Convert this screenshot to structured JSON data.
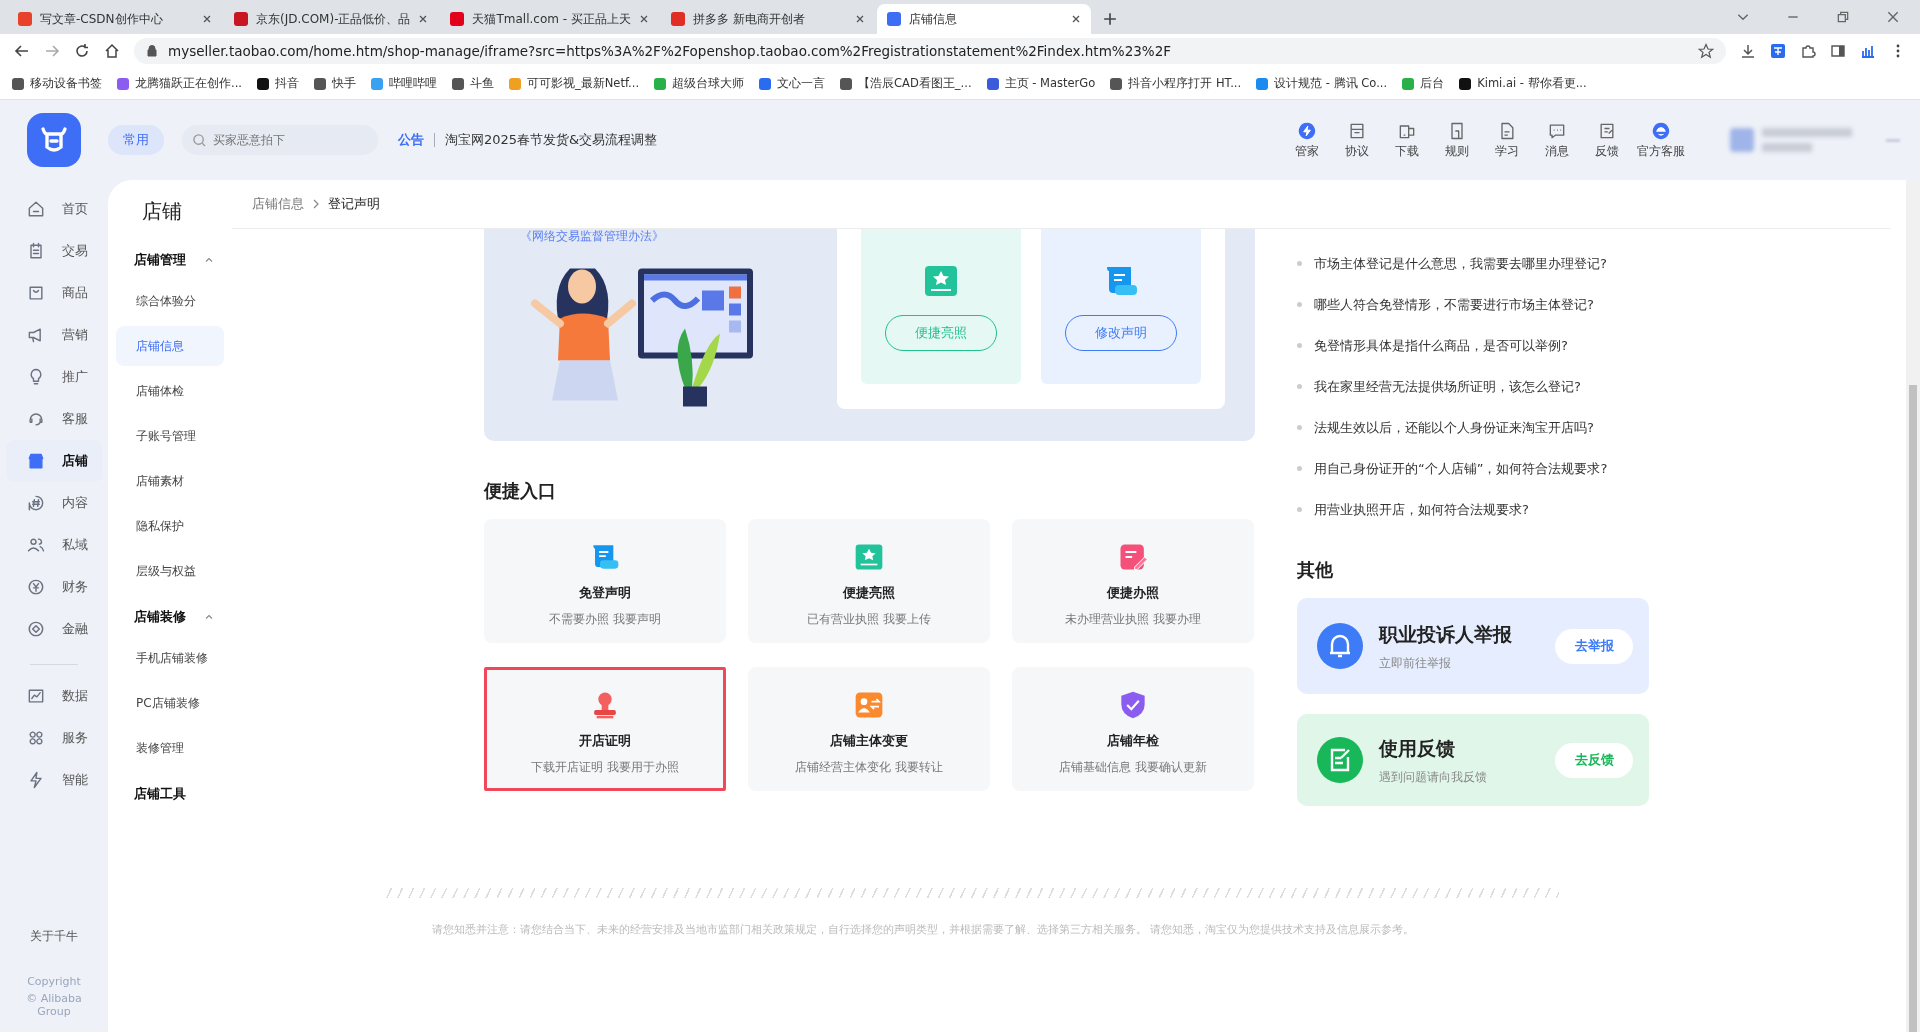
{
  "browser": {
    "tabs": [
      {
        "title": "写文章-CSDN创作中心",
        "selected": false
      },
      {
        "title": "京东(JD.COM)-正品低价、品",
        "selected": false
      },
      {
        "title": "天猫Tmall.com - 买正品上天",
        "selected": false
      },
      {
        "title": "拼多多 新电商开创者",
        "selected": false
      },
      {
        "title": "店铺信息",
        "selected": true
      }
    ],
    "url": "myseller.taobao.com/home.htm/shop-manage/iframe?src=https%3A%2F%2Fopenshop.taobao.com%2Fregistrationstatement%2Findex.htm%23%2F",
    "bookmarks": [
      "移动设备书签",
      "龙腾猫跃正在创作...",
      "抖音",
      "快手",
      "哔哩哔哩",
      "斗鱼",
      "可可影视_最新Netf...",
      "超级台球大师",
      "文心一言",
      "【浩辰CAD看图王_...",
      "主页 - MasterGo",
      "抖音小程序打开 HT...",
      "设计规范 - 腾讯 Co...",
      "后台",
      "Kimi.ai - 帮你看更..."
    ]
  },
  "header": {
    "pill": "常用",
    "search": {
      "placeholder": "买家恶意拍下"
    },
    "notice_label": "公告",
    "notice": "淘宝网2025春节发货&交易流程调整",
    "tools": [
      "管家",
      "协议",
      "下载",
      "规则",
      "学习",
      "消息",
      "反馈",
      "官方客服"
    ]
  },
  "rail": {
    "groups": [
      {
        "items": [
          {
            "label": "首页",
            "selected": false
          },
          {
            "label": "交易",
            "selected": false
          },
          {
            "label": "商品",
            "selected": false
          },
          {
            "label": "营销",
            "selected": false
          },
          {
            "label": "推广",
            "selected": false
          },
          {
            "label": "客服",
            "selected": false
          },
          {
            "label": "店铺",
            "selected": true
          },
          {
            "label": "内容",
            "selected": false
          },
          {
            "label": "私域",
            "selected": false
          },
          {
            "label": "财务",
            "selected": false
          },
          {
            "label": "金融",
            "selected": false
          }
        ]
      },
      {
        "items": [
          {
            "label": "数据",
            "selected": false
          },
          {
            "label": "服务",
            "selected": false
          },
          {
            "label": "智能",
            "selected": false
          }
        ]
      }
    ],
    "about": "关于千牛",
    "copyright": "Copyright",
    "company": "© Alibaba Group"
  },
  "sidebar": {
    "title": "店铺",
    "groups": [
      {
        "kind": "collapsible",
        "label": "店铺管理",
        "expanded": true,
        "items": [
          {
            "label": "综合体验分",
            "selected": false
          },
          {
            "label": "店铺信息",
            "selected": true
          },
          {
            "label": "店铺体检",
            "selected": false
          },
          {
            "label": "子账号管理",
            "selected": false
          },
          {
            "label": "店铺素材",
            "selected": false
          },
          {
            "label": "隐私保护",
            "selected": false
          },
          {
            "label": "层级与权益",
            "selected": false
          }
        ]
      },
      {
        "kind": "collapsible",
        "label": "店铺装修",
        "expanded": true,
        "items": [
          {
            "label": "手机店铺装修",
            "selected": false
          },
          {
            "label": "PC店铺装修",
            "selected": false
          },
          {
            "label": "装修管理",
            "selected": false
          }
        ]
      },
      {
        "kind": "link",
        "label": "店铺工具"
      }
    ]
  },
  "breadcrumb": [
    "店铺信息",
    "登记声明"
  ],
  "banner": {
    "law_link": "《网络交易监督管理办法》",
    "actions": [
      {
        "label": "便捷亮照",
        "color": "#1fbf8f"
      },
      {
        "label": "修改声明",
        "color": "#3d7bf7"
      }
    ]
  },
  "quick_entry": {
    "title": "便捷入口",
    "cards": [
      {
        "title": "免登声明",
        "subtitle": "不需要办照 我要声明",
        "highlighted": false
      },
      {
        "title": "便捷亮照",
        "subtitle": "已有营业执照 我要上传",
        "highlighted": false
      },
      {
        "title": "便捷办照",
        "subtitle": "未办理营业执照 我要办理",
        "highlighted": false
      },
      {
        "title": "开店证明",
        "subtitle": "下载开店证明 我要用于办照",
        "highlighted": true
      },
      {
        "title": "店铺主体变更",
        "subtitle": "店铺经营主体变化 我要转让",
        "highlighted": false
      },
      {
        "title": "店铺年检",
        "subtitle": "店铺基础信息 我要确认更新",
        "highlighted": false
      }
    ]
  },
  "faq": [
    "市场主体登记是什么意思，我需要去哪里办理登记?",
    "哪些人符合免登情形，不需要进行市场主体登记?",
    "免登情形具体是指什么商品，是否可以举例?",
    "我在家里经营无法提供场所证明，该怎么登记?",
    "法规生效以后，还能以个人身份证来淘宝开店吗?",
    "用自己身份证开的“个人店铺”，如何符合法规要求?",
    "用营业执照开店，如何符合法规要求?"
  ],
  "other": {
    "title": "其他",
    "cards": [
      {
        "title": "职业投诉人举报",
        "subtitle": "立即前往举报",
        "button": "去举报",
        "color": "#3d7bf7"
      },
      {
        "title": "使用反馈",
        "subtitle": "遇到问题请向我反馈",
        "button": "去反馈",
        "color": "#18b85a"
      }
    ]
  },
  "disclaimer": "请您知悉并注意：请您结合当下、未来的经营安排及当地市监部门相关政策规定，自行选择您的声明类型，并根据需要了解、选择第三方相关服务。 请您知悉，淘宝仅为您提供技术支持及信息展示参考。"
}
